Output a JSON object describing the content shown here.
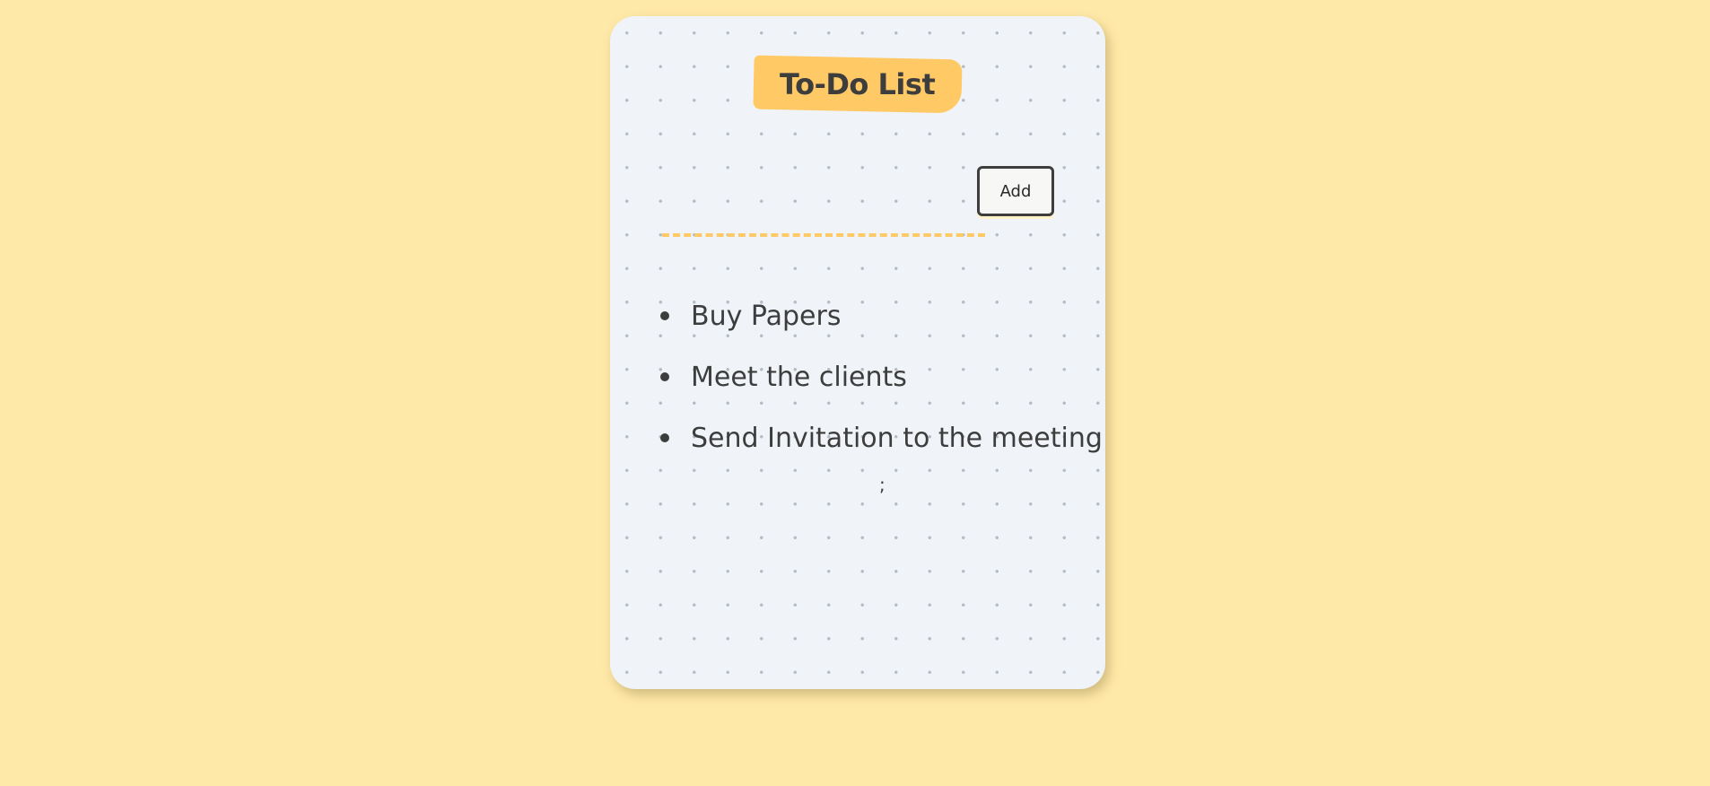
{
  "app": {
    "title": "To-Do List"
  },
  "form": {
    "input_value": "",
    "input_placeholder": "",
    "add_label": "Add"
  },
  "tasks": [
    {
      "label": "Buy Papers"
    },
    {
      "label": "Meet the clients"
    },
    {
      "label": "Send Invitation to the meeting"
    }
  ],
  "footer": {
    "stray_text": ";"
  },
  "colors": {
    "page_background": "#ffe9a8",
    "card_background": "#f0f4f8",
    "accent": "#ffc966",
    "text": "#3d3d3d"
  }
}
